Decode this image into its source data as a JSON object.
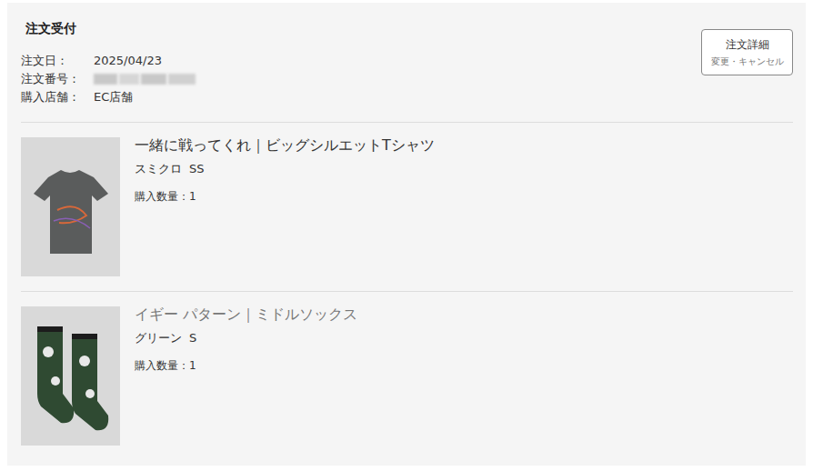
{
  "title": "注文受付",
  "info": [
    {
      "label": "注文日：",
      "value": "2025/04/23",
      "redacted": false
    },
    {
      "label": "注文番号：",
      "value": "",
      "redacted": true
    },
    {
      "label": "購入店舗：",
      "value": "EC店舗",
      "redacted": false
    }
  ],
  "detail_button": {
    "label": "注文詳細",
    "sublabel": "変更・キャンセル"
  },
  "items": [
    {
      "name": "一緒に戦ってくれ｜ビッグシルエットTシャツ",
      "color": "スミクロ",
      "size": "SS",
      "quantity": "購入数量：1",
      "greyed": false,
      "kind": "tshirt"
    },
    {
      "name": "イギー パターン｜ミドルソックス",
      "color": "グリーン",
      "size": "S",
      "quantity": "購入数量：1",
      "greyed": true,
      "kind": "socks"
    }
  ]
}
